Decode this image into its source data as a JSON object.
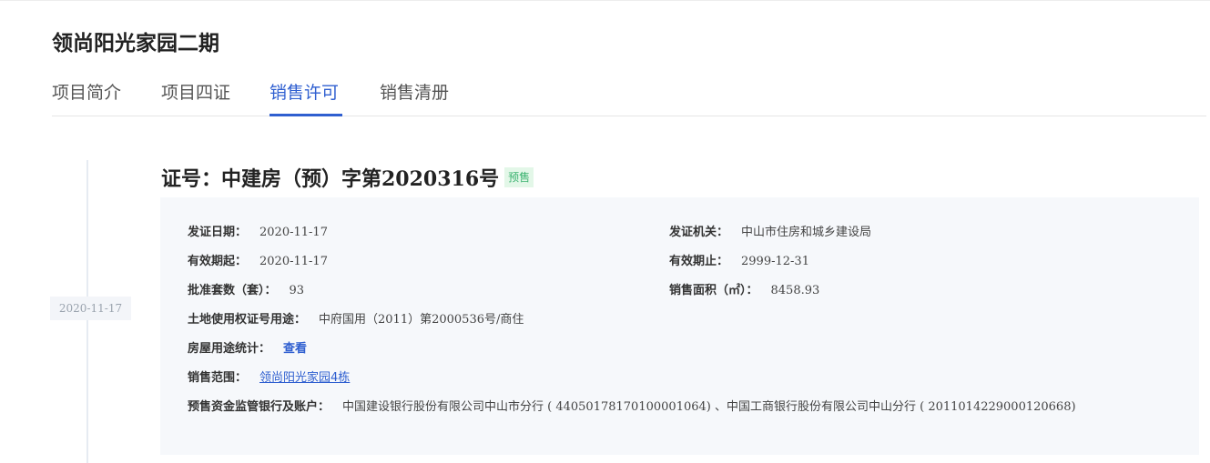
{
  "project": {
    "title": "领尚阳光家园二期"
  },
  "tabs": [
    {
      "label": "项目简介",
      "active": false
    },
    {
      "label": "项目四证",
      "active": false
    },
    {
      "label": "销售许可",
      "active": true
    },
    {
      "label": "销售清册",
      "active": false
    }
  ],
  "timeline": {
    "date": "2020-11-17"
  },
  "permit": {
    "number": "证号：中建房（预）字第2020316号",
    "badge": "预售",
    "fields": {
      "issue_date": {
        "label": "发证日期：",
        "value": "2020-11-17"
      },
      "issuer": {
        "label": "发证机关：",
        "value": "中山市住房和城乡建设局"
      },
      "valid_from": {
        "label": "有效期起：",
        "value": "2020-11-17"
      },
      "valid_to": {
        "label": "有效期止：",
        "value": "2999-12-31"
      },
      "approved_units": {
        "label": "批准套数（套）：",
        "value": "93"
      },
      "sales_area": {
        "label": "销售面积（㎡）：",
        "value": "8458.93"
      },
      "land_cert": {
        "label": "土地使用权证号用途：",
        "value": "中府国用（2011）第2000536号/商住"
      },
      "usage_stats": {
        "label": "房屋用途统计：",
        "link": "查看"
      },
      "sales_scope": {
        "label": "销售范围：",
        "link": "领尚阳光家园4栋"
      },
      "escrow": {
        "label": "预售资金监管银行及账户：",
        "value": "中国建设银行股份有限公司中山市分行 ( 44050178170100001064) 、中国工商银行股份有限公司中山分行 ( 2011014229000120668)"
      }
    }
  },
  "colors": {
    "accent": "#2f5fd0",
    "badge_bg": "#e3f7e8",
    "badge_text": "#3cb371",
    "card_bg": "#f6f8fb"
  }
}
